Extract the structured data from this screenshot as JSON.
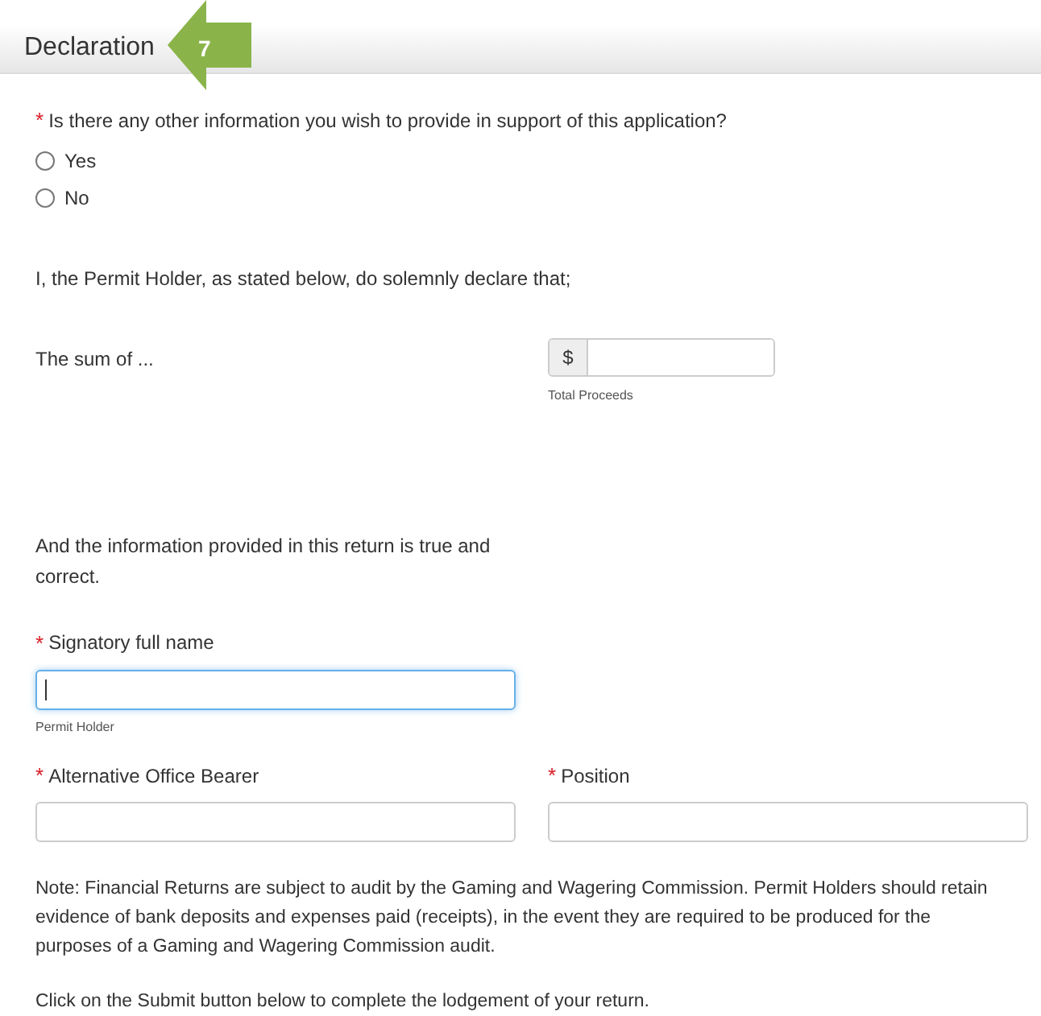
{
  "header": {
    "title": "Declaration",
    "step_badge": "7"
  },
  "question": {
    "label": "Is there any other information you wish to provide in support of this application?",
    "required_mark": "*",
    "options": [
      {
        "label": "Yes",
        "selected": false
      },
      {
        "label": "No",
        "selected": false
      }
    ]
  },
  "declaration_intro": "I, the Permit Holder, as stated below, do solemnly declare that;",
  "sum": {
    "label": "The sum of ...",
    "prefix": "$",
    "help": "Total Proceeds"
  },
  "statement": "And the information provided in this return is true and correct.",
  "signatory": {
    "label": "Signatory full name",
    "required_mark": "*",
    "focused": true,
    "help": "Permit Holder"
  },
  "fields": [
    {
      "label": "Alternative Office Bearer",
      "required_mark": "*"
    },
    {
      "label": "Position",
      "required_mark": "*"
    }
  ],
  "note": "Note: Financial Returns are subject to audit by the Gaming and Wagering Commission. Permit Holders should retain evidence of bank deposits and expenses paid (receipts), in the event they are required to be produced for the purposes of a Gaming and Wagering Commission audit.",
  "instruction": "Click on the Submit button below to complete the lodgement of your return."
}
